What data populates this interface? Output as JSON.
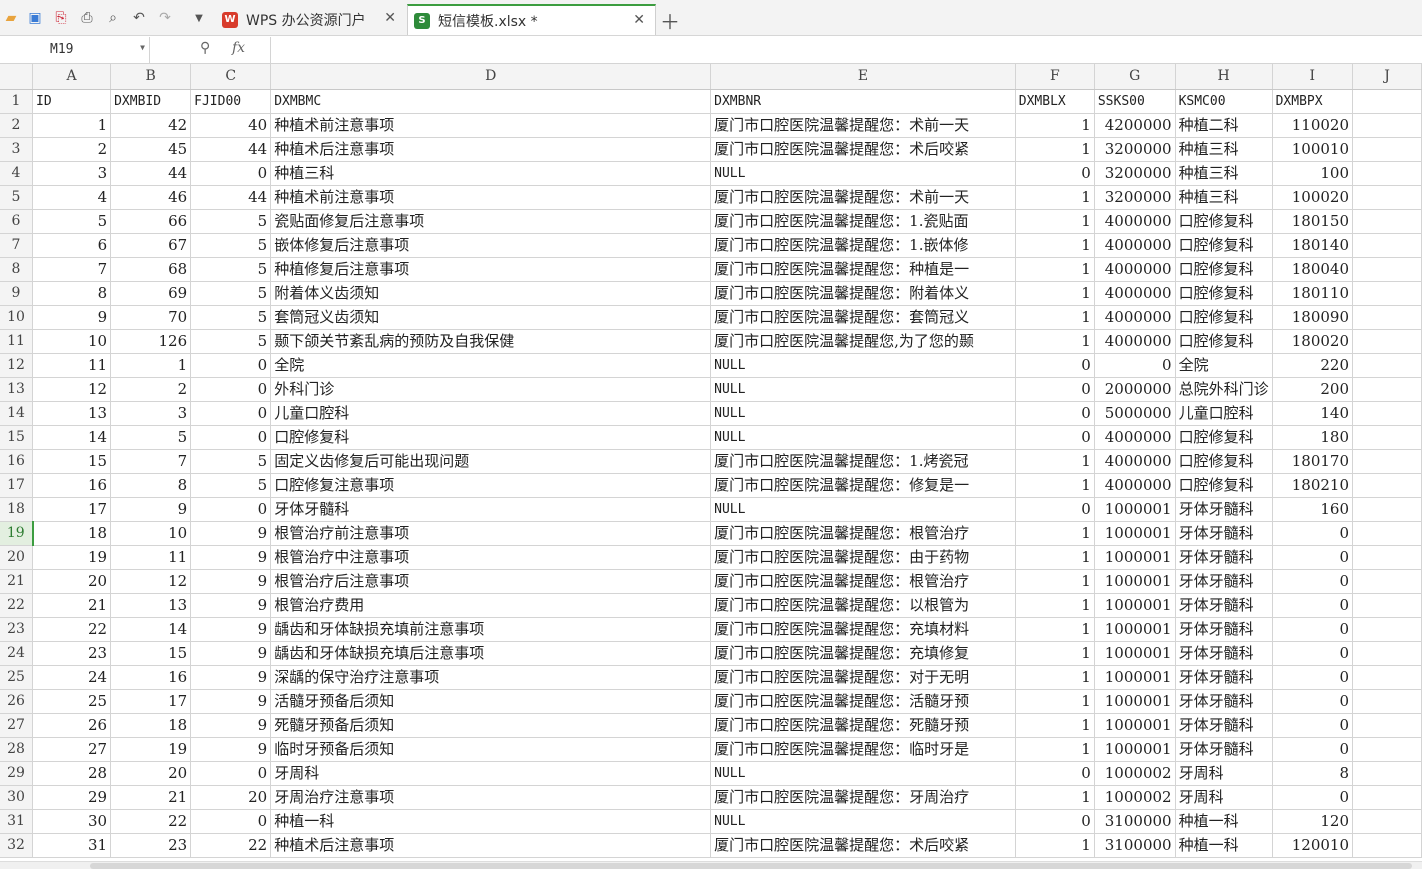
{
  "tabs": [
    {
      "label": "WPS 办公资源门户",
      "badge": "W",
      "badge_color": "#d83b2b"
    },
    {
      "label": "短信模板.xlsx *",
      "badge": "S",
      "badge_color": "#2e8b3a"
    }
  ],
  "name_box": "M19",
  "fx_label": "fx",
  "columns": [
    "A",
    "B",
    "C",
    "D",
    "E",
    "F",
    "G",
    "H",
    "I",
    "J"
  ],
  "header_row": [
    "ID",
    "DXMBID",
    "FJID00",
    "DXMBMC",
    "DXMBNR",
    "DXMBLX",
    "SSKS00",
    "KSMC00",
    "DXMBPX",
    ""
  ],
  "rows": [
    [
      "1",
      "42",
      "40",
      "种植术前注意事项",
      "厦门市口腔医院温馨提醒您：术前一天",
      "1",
      "4200000",
      "种植二科",
      "110020"
    ],
    [
      "2",
      "45",
      "44",
      "种植术后注意事项",
      "厦门市口腔医院温馨提醒您：术后咬紧",
      "1",
      "3200000",
      "种植三科",
      "100010"
    ],
    [
      "3",
      "44",
      "0",
      "种植三科",
      "NULL",
      "0",
      "3200000",
      "种植三科",
      "100"
    ],
    [
      "4",
      "46",
      "44",
      "种植术前注意事项",
      "厦门市口腔医院温馨提醒您：术前一天",
      "1",
      "3200000",
      "种植三科",
      "100020"
    ],
    [
      "5",
      "66",
      "5",
      "瓷贴面修复后注意事项",
      "厦门市口腔医院温馨提醒您：1.瓷贴面",
      "1",
      "4000000",
      "口腔修复科",
      "180150"
    ],
    [
      "6",
      "67",
      "5",
      "嵌体修复后注意事项",
      "厦门市口腔医院温馨提醒您：1.嵌体修",
      "1",
      "4000000",
      "口腔修复科",
      "180140"
    ],
    [
      "7",
      "68",
      "5",
      "种植修复后注意事项",
      "厦门市口腔医院温馨提醒您：种植是一",
      "1",
      "4000000",
      "口腔修复科",
      "180040"
    ],
    [
      "8",
      "69",
      "5",
      "附着体义齿须知",
      "厦门市口腔医院温馨提醒您：附着体义",
      "1",
      "4000000",
      "口腔修复科",
      "180110"
    ],
    [
      "9",
      "70",
      "5",
      "套筒冠义齿须知",
      "厦门市口腔医院温馨提醒您：套筒冠义",
      "1",
      "4000000",
      "口腔修复科",
      "180090"
    ],
    [
      "10",
      "126",
      "5",
      "颞下颌关节紊乱病的预防及自我保健",
      "厦门市口腔医院温馨提醒您,为了您的颞",
      "1",
      "4000000",
      "口腔修复科",
      "180020"
    ],
    [
      "11",
      "1",
      "0",
      "全院",
      "NULL",
      "0",
      "0",
      "全院",
      "220"
    ],
    [
      "12",
      "2",
      "0",
      "外科门诊",
      "NULL",
      "0",
      "2000000",
      "总院外科门诊",
      "200"
    ],
    [
      "13",
      "3",
      "0",
      "儿童口腔科",
      "NULL",
      "0",
      "5000000",
      "儿童口腔科",
      "140"
    ],
    [
      "14",
      "5",
      "0",
      "口腔修复科",
      "NULL",
      "0",
      "4000000",
      "口腔修复科",
      "180"
    ],
    [
      "15",
      "7",
      "5",
      "固定义齿修复后可能出现问题",
      "厦门市口腔医院温馨提醒您：1.烤瓷冠",
      "1",
      "4000000",
      "口腔修复科",
      "180170"
    ],
    [
      "16",
      "8",
      "5",
      "口腔修复注意事项",
      "厦门市口腔医院温馨提醒您：修复是一",
      "1",
      "4000000",
      "口腔修复科",
      "180210"
    ],
    [
      "17",
      "9",
      "0",
      "牙体牙髓科",
      "NULL",
      "0",
      "1000001",
      "牙体牙髓科",
      "160"
    ],
    [
      "18",
      "10",
      "9",
      "根管治疗前注意事项",
      "厦门市口腔医院温馨提醒您：根管治疗",
      "1",
      "1000001",
      "牙体牙髓科",
      "0"
    ],
    [
      "19",
      "11",
      "9",
      "根管治疗中注意事项",
      "厦门市口腔医院温馨提醒您：由于药物",
      "1",
      "1000001",
      "牙体牙髓科",
      "0"
    ],
    [
      "20",
      "12",
      "9",
      "根管治疗后注意事项",
      "厦门市口腔医院温馨提醒您：根管治疗",
      "1",
      "1000001",
      "牙体牙髓科",
      "0"
    ],
    [
      "21",
      "13",
      "9",
      "根管治疗费用",
      "厦门市口腔医院温馨提醒您：以根管为",
      "1",
      "1000001",
      "牙体牙髓科",
      "0"
    ],
    [
      "22",
      "14",
      "9",
      "龋齿和牙体缺损充填前注意事项",
      "厦门市口腔医院温馨提醒您：充填材料",
      "1",
      "1000001",
      "牙体牙髓科",
      "0"
    ],
    [
      "23",
      "15",
      "9",
      "龋齿和牙体缺损充填后注意事项",
      "厦门市口腔医院温馨提醒您：充填修复",
      "1",
      "1000001",
      "牙体牙髓科",
      "0"
    ],
    [
      "24",
      "16",
      "9",
      "深龋的保守治疗注意事项",
      "厦门市口腔医院温馨提醒您：对于无明",
      "1",
      "1000001",
      "牙体牙髓科",
      "0"
    ],
    [
      "25",
      "17",
      "9",
      "活髓牙预备后须知",
      "厦门市口腔医院温馨提醒您：活髓牙预",
      "1",
      "1000001",
      "牙体牙髓科",
      "0"
    ],
    [
      "26",
      "18",
      "9",
      "死髓牙预备后须知",
      "厦门市口腔医院温馨提醒您：死髓牙预",
      "1",
      "1000001",
      "牙体牙髓科",
      "0"
    ],
    [
      "27",
      "19",
      "9",
      "临时牙预备后须知",
      "厦门市口腔医院温馨提醒您：临时牙是",
      "1",
      "1000001",
      "牙体牙髓科",
      "0"
    ],
    [
      "28",
      "20",
      "0",
      "牙周科",
      "NULL",
      "0",
      "1000002",
      "牙周科",
      "8"
    ],
    [
      "29",
      "21",
      "20",
      "牙周治疗注意事项",
      "厦门市口腔医院温馨提醒您：牙周治疗",
      "1",
      "1000002",
      "牙周科",
      "0"
    ],
    [
      "30",
      "22",
      "0",
      "种植一科",
      "NULL",
      "0",
      "3100000",
      "种植一科",
      "120"
    ],
    [
      "31",
      "23",
      "22",
      "种植术后注意事项",
      "厦门市口腔医院温馨提醒您：术后咬紧",
      "1",
      "3100000",
      "种植一科",
      "120010"
    ]
  ],
  "selected_row": 19,
  "colors": {
    "accent": "#3c9d40"
  }
}
